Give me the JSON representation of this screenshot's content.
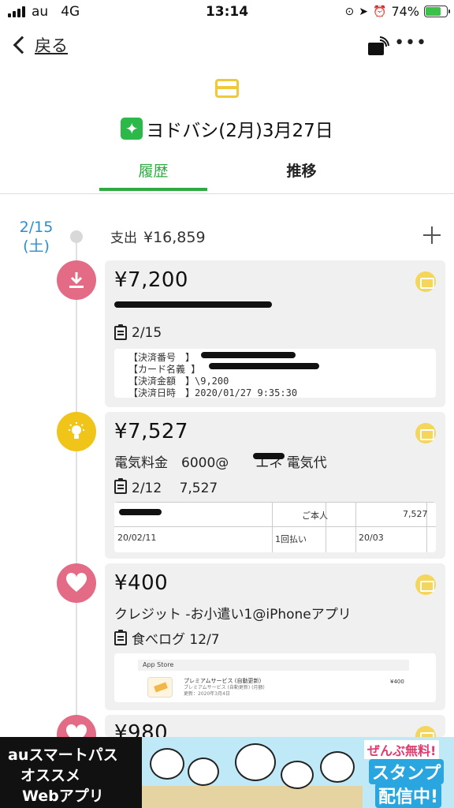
{
  "status_bar": {
    "carrier": "au",
    "network": "4G",
    "time": "13:14",
    "battery": "74%",
    "battery_level": 0.74
  },
  "nav": {
    "back_label": "戻る",
    "more_label": "•••"
  },
  "header": {
    "title": "ヨドバシ(2月)3月27日",
    "sparkle": "✦"
  },
  "tabs": [
    {
      "label": "履歴",
      "active": true
    },
    {
      "label": "推移",
      "active": false
    }
  ],
  "timeline": {
    "date_line1": "2/15",
    "date_line2": "(土)",
    "spend_label": "支出",
    "spend_amount": "¥16,859"
  },
  "entries": [
    {
      "amount": "¥7,200",
      "memo": "2/15",
      "receipt_lines": [
        "【決済番号　】",
        "【カード名義 】",
        "【決済金額　】\\9,200",
        "【決済日時　】2020/01/27 9:35:30"
      ],
      "icon": "download-icon",
      "color": "#e36b85"
    },
    {
      "amount": "¥7,527",
      "desc": "電気料金　6000@　　エネ 電気代",
      "memo": "2/12　 7,527",
      "table": {
        "r1c2": "ご本人",
        "r1c3": "7,527",
        "r2c1": "20/02/11",
        "r2c2": "1回払い",
        "r2c3": "20/03"
      },
      "icon": "lightbulb-icon",
      "color": "#f0c419"
    },
    {
      "amount": "¥400",
      "desc": "クレジット -お小遣い1@iPhoneアプリ",
      "memo": "食べログ 12/7",
      "app_receipt": {
        "header": "App Store",
        "line1": "プレミアムサービス (自動更新)",
        "line2": "プレミアムサービス (自動更新) (月額)",
        "line3": "更新：2020年3月4日",
        "price": "¥400"
      },
      "icon": "heart-icon",
      "color": "#e36b85"
    },
    {
      "amount": "¥980",
      "icon": "heart-icon",
      "color": "#e36b85"
    }
  ],
  "ad": {
    "left_line1": "auスマートパス",
    "left_line2": "オススメ",
    "left_line3": "Webアプリ",
    "right_line1": "ぜんぶ無料!",
    "right_line2": "スタンプ",
    "right_line3": "配信中!"
  },
  "colors": {
    "accent_green": "#2eab3f",
    "date_blue": "#2a8fd0",
    "card_yellow": "#f3d65a"
  }
}
